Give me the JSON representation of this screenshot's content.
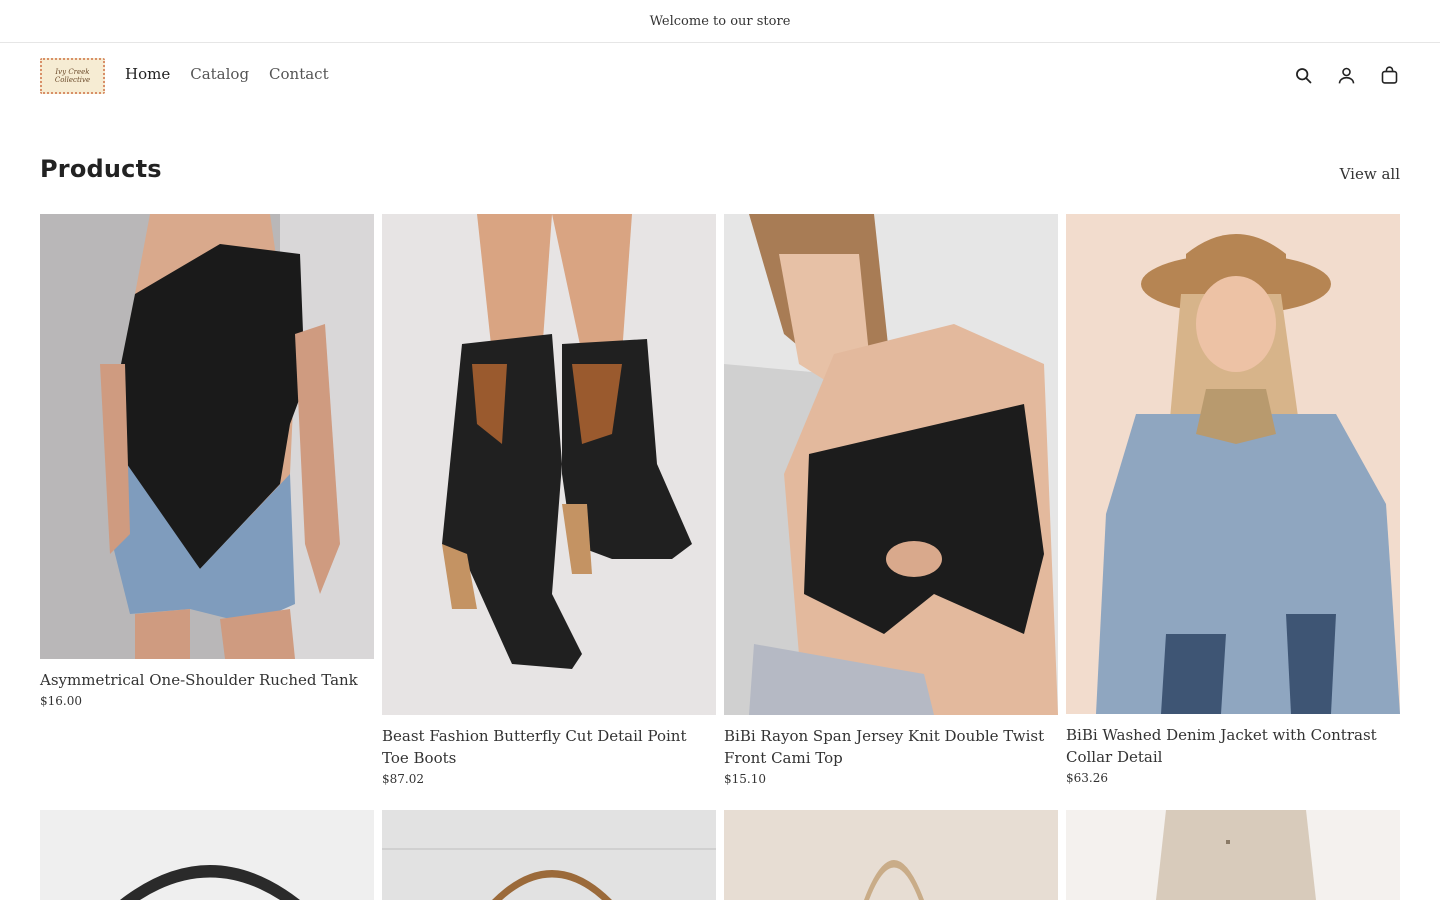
{
  "announcement": "Welcome to our store",
  "header": {
    "logo_text": "Ivy Creek Collective",
    "nav": [
      {
        "label": "Home",
        "active": true
      },
      {
        "label": "Catalog",
        "active": false
      },
      {
        "label": "Contact",
        "active": false
      }
    ],
    "icons": [
      "search-icon",
      "account-icon",
      "cart-icon"
    ]
  },
  "products_section": {
    "title": "Products",
    "view_all": "View all",
    "items": [
      {
        "title": "Asymmetrical One-Shoulder Ruched Tank",
        "price": "$16.00"
      },
      {
        "title": "Beast Fashion Butterfly Cut Detail Point Toe Boots",
        "price": "$87.02"
      },
      {
        "title": "BiBi Rayon Span Jersey Knit Double Twist Front Cami Top",
        "price": "$15.10"
      },
      {
        "title": "BiBi Washed Denim Jacket with Contrast Collar Detail",
        "price": "$63.26"
      }
    ]
  },
  "colors": {
    "text": "#222222",
    "border": "#e6e6e6",
    "background": "#ffffff"
  }
}
